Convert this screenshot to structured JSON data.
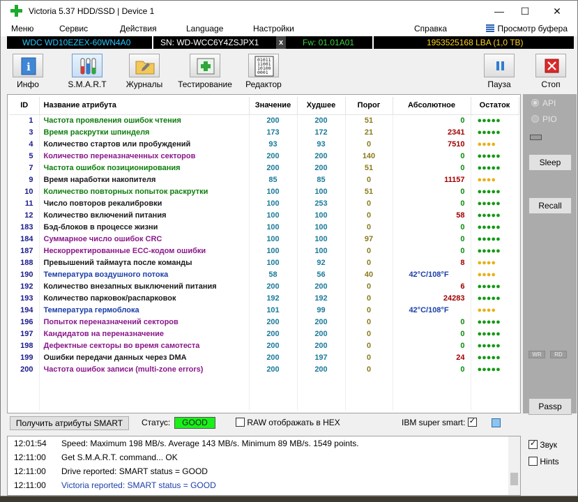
{
  "window": {
    "title": "Victoria 5.37 HDD/SSD | Device 1",
    "minimize": "—",
    "maximize": "☐",
    "close": "✕"
  },
  "menu": {
    "items": [
      "Меню",
      "Сервис",
      "Действия",
      "Language",
      "Настройки",
      "Справка"
    ],
    "buffer": "Просмотр буфера"
  },
  "device": {
    "model": "WDC WD10EZEX-60WN4A0",
    "serial": "SN: WD-WCC6Y4ZSJPX1",
    "close": "x",
    "firmware": "Fw: 01.01A01",
    "lba": "1953525168 LBA (1,0 TB)"
  },
  "toolbar": {
    "info": "Инфо",
    "smart": "S.M.A.R.T",
    "logs": "Журналы",
    "test": "Тестирование",
    "editor": "Редактор",
    "pause": "Пауза",
    "stop": "Стоп",
    "editor_glyph": "01011\n11001\n10100\n0001"
  },
  "table": {
    "headers": {
      "id": "ID",
      "name": "Название атрибута",
      "value": "Значение",
      "worst": "Худшее",
      "threshold": "Порог",
      "raw": "Абсолютное",
      "health": "Остаток"
    },
    "rows": [
      {
        "id": "1",
        "name": "Частота проявления ошибок чтения",
        "color": "green",
        "value": "200",
        "worst": "200",
        "threshold": "51",
        "raw": "0",
        "raw_kind": "num",
        "health": "●●●●●",
        "health_color": "green"
      },
      {
        "id": "3",
        "name": "Время раскрутки шпинделя",
        "color": "green",
        "value": "173",
        "worst": "172",
        "threshold": "21",
        "raw": "2341",
        "raw_kind": "num",
        "health": "●●●●●",
        "health_color": "green"
      },
      {
        "id": "4",
        "name": "Количество стартов или пробуждений",
        "color": "black",
        "value": "93",
        "worst": "93",
        "threshold": "0",
        "raw": "7510",
        "raw_kind": "num",
        "health": "●●●●",
        "health_color": "yellow"
      },
      {
        "id": "5",
        "name": "Количество переназначенных секторов",
        "color": "purple",
        "value": "200",
        "worst": "200",
        "threshold": "140",
        "raw": "0",
        "raw_kind": "num",
        "health": "●●●●●",
        "health_color": "green"
      },
      {
        "id": "7",
        "name": "Частота ошибок позиционирования",
        "color": "green",
        "value": "200",
        "worst": "200",
        "threshold": "51",
        "raw": "0",
        "raw_kind": "num",
        "health": "●●●●●",
        "health_color": "green"
      },
      {
        "id": "9",
        "name": "Время наработки накопителя",
        "color": "black",
        "value": "85",
        "worst": "85",
        "threshold": "0",
        "raw": "11157",
        "raw_kind": "num",
        "health": "●●●●",
        "health_color": "yellow"
      },
      {
        "id": "10",
        "name": "Количество повторных попыток раскрутки",
        "color": "green",
        "value": "100",
        "worst": "100",
        "threshold": "51",
        "raw": "0",
        "raw_kind": "num",
        "health": "●●●●●",
        "health_color": "green"
      },
      {
        "id": "11",
        "name": "Число повторов рекалибровки",
        "color": "black",
        "value": "100",
        "worst": "253",
        "threshold": "0",
        "raw": "0",
        "raw_kind": "num",
        "health": "●●●●●",
        "health_color": "green"
      },
      {
        "id": "12",
        "name": "Количество включений питания",
        "color": "black",
        "value": "100",
        "worst": "100",
        "threshold": "0",
        "raw": "58",
        "raw_kind": "num",
        "health": "●●●●●",
        "health_color": "green"
      },
      {
        "id": "183",
        "name": "Бэд-блоков в процессе жизни",
        "color": "black",
        "value": "100",
        "worst": "100",
        "threshold": "0",
        "raw": "0",
        "raw_kind": "zero",
        "health": "●●●●●",
        "health_color": "green"
      },
      {
        "id": "184",
        "name": "Суммарное число ошибок CRC",
        "color": "purple",
        "value": "100",
        "worst": "100",
        "threshold": "97",
        "raw": "0",
        "raw_kind": "zero",
        "health": "●●●●●",
        "health_color": "green"
      },
      {
        "id": "187",
        "name": "Нескорректированные ECC-кодом ошибки",
        "color": "purple",
        "value": "100",
        "worst": "100",
        "threshold": "0",
        "raw": "0",
        "raw_kind": "zero",
        "health": "●●●●●",
        "health_color": "green"
      },
      {
        "id": "188",
        "name": "Превышений таймаута после команды",
        "color": "black",
        "value": "100",
        "worst": "92",
        "threshold": "0",
        "raw": "8",
        "raw_kind": "num",
        "health": "●●●●",
        "health_color": "yellow"
      },
      {
        "id": "190",
        "name": "Температура воздушного потока",
        "color": "blue",
        "value": "58",
        "worst": "56",
        "threshold": "40",
        "raw": "42°C/108°F",
        "raw_kind": "temp",
        "health": "●●●●",
        "health_color": "yellow"
      },
      {
        "id": "192",
        "name": "Количество внезапных выключений питания",
        "color": "black",
        "value": "200",
        "worst": "200",
        "threshold": "0",
        "raw": "6",
        "raw_kind": "num",
        "health": "●●●●●",
        "health_color": "green"
      },
      {
        "id": "193",
        "name": "Количество парковок/распарковок",
        "color": "black",
        "value": "192",
        "worst": "192",
        "threshold": "0",
        "raw": "24283",
        "raw_kind": "num",
        "health": "●●●●●",
        "health_color": "green"
      },
      {
        "id": "194",
        "name": "Температура гермоблока",
        "color": "blue",
        "value": "101",
        "worst": "99",
        "threshold": "0",
        "raw": "42°C/108°F",
        "raw_kind": "temp",
        "health": "●●●●",
        "health_color": "yellow"
      },
      {
        "id": "196",
        "name": "Попыток переназначений секторов",
        "color": "purple",
        "value": "200",
        "worst": "200",
        "threshold": "0",
        "raw": "0",
        "raw_kind": "zero",
        "health": "●●●●●",
        "health_color": "green"
      },
      {
        "id": "197",
        "name": "Кандидатов на переназначение",
        "color": "purple",
        "value": "200",
        "worst": "200",
        "threshold": "0",
        "raw": "0",
        "raw_kind": "zero",
        "health": "●●●●●",
        "health_color": "green"
      },
      {
        "id": "198",
        "name": "Дефектные секторы во время самотеста",
        "color": "purple",
        "value": "200",
        "worst": "200",
        "threshold": "0",
        "raw": "0",
        "raw_kind": "zero",
        "health": "●●●●●",
        "health_color": "green"
      },
      {
        "id": "199",
        "name": "Ошибки передачи данных через DMA",
        "color": "black",
        "value": "200",
        "worst": "197",
        "threshold": "0",
        "raw": "24",
        "raw_kind": "num",
        "health": "●●●●●",
        "health_color": "green"
      },
      {
        "id": "200",
        "name": "Частота ошибок записи (multi-zone errors)",
        "color": "purple",
        "value": "200",
        "worst": "200",
        "threshold": "0",
        "raw": "0",
        "raw_kind": "zero",
        "health": "●●●●●",
        "health_color": "green"
      }
    ]
  },
  "side": {
    "api": "API",
    "pio": "PIO",
    "sleep": "Sleep",
    "recall": "Recall",
    "wr": "WR",
    "rd": "RD",
    "passp": "Passp"
  },
  "status": {
    "get_smart": "Получить атрибуты SMART",
    "label": "Статус:",
    "value": "GOOD",
    "hex": "RAW отображать в HEX",
    "ibm": "IBM super smart:"
  },
  "log": [
    {
      "time": "12:01:54",
      "msg": "Speed: Maximum 198 MB/s. Average 143 MB/s. Minimum 89 MB/s. 1549 points.",
      "color": "#000000"
    },
    {
      "time": "12:11:00",
      "msg": "Get S.M.A.R.T. command... OK",
      "color": "#000000"
    },
    {
      "time": "12:11:00",
      "msg": "Drive reported: SMART status = GOOD",
      "color": "#000000"
    },
    {
      "time": "12:11:00",
      "msg": "Victoria reported: SMART status = GOOD",
      "color": "#1a3ea8"
    }
  ],
  "options": {
    "sound": "Звук",
    "hints": "Hints"
  }
}
